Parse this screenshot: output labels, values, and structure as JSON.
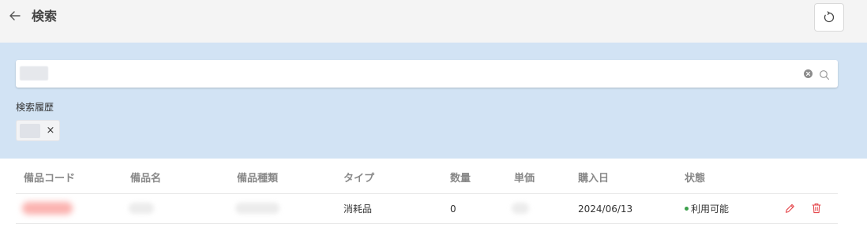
{
  "header": {
    "title": "検索",
    "back_icon": "arrow-left-icon",
    "refresh_icon": "refresh-icon"
  },
  "search": {
    "value": "",
    "placeholder": "",
    "clear_icon": "clear-circle-icon",
    "search_icon": "search-icon"
  },
  "history": {
    "label": "検索履歴",
    "items": [
      {
        "text": "",
        "close_label": "×"
      }
    ]
  },
  "table": {
    "columns": [
      "備品コード",
      "備品名",
      "備品種類",
      "タイプ",
      "数量",
      "単価",
      "購入日",
      "状態"
    ],
    "rows": [
      {
        "code": "",
        "name": "",
        "category": "",
        "type": "消耗品",
        "quantity": "0",
        "unit_price": "",
        "purchase_date": "2024/06/13",
        "status": "利用可能",
        "edit_icon": "pencil-icon",
        "delete_icon": "trash-icon"
      }
    ]
  },
  "colors": {
    "search_bg": "#d2e3f4",
    "status_ok": "#3ca04b",
    "action_red": "#e5484d"
  }
}
